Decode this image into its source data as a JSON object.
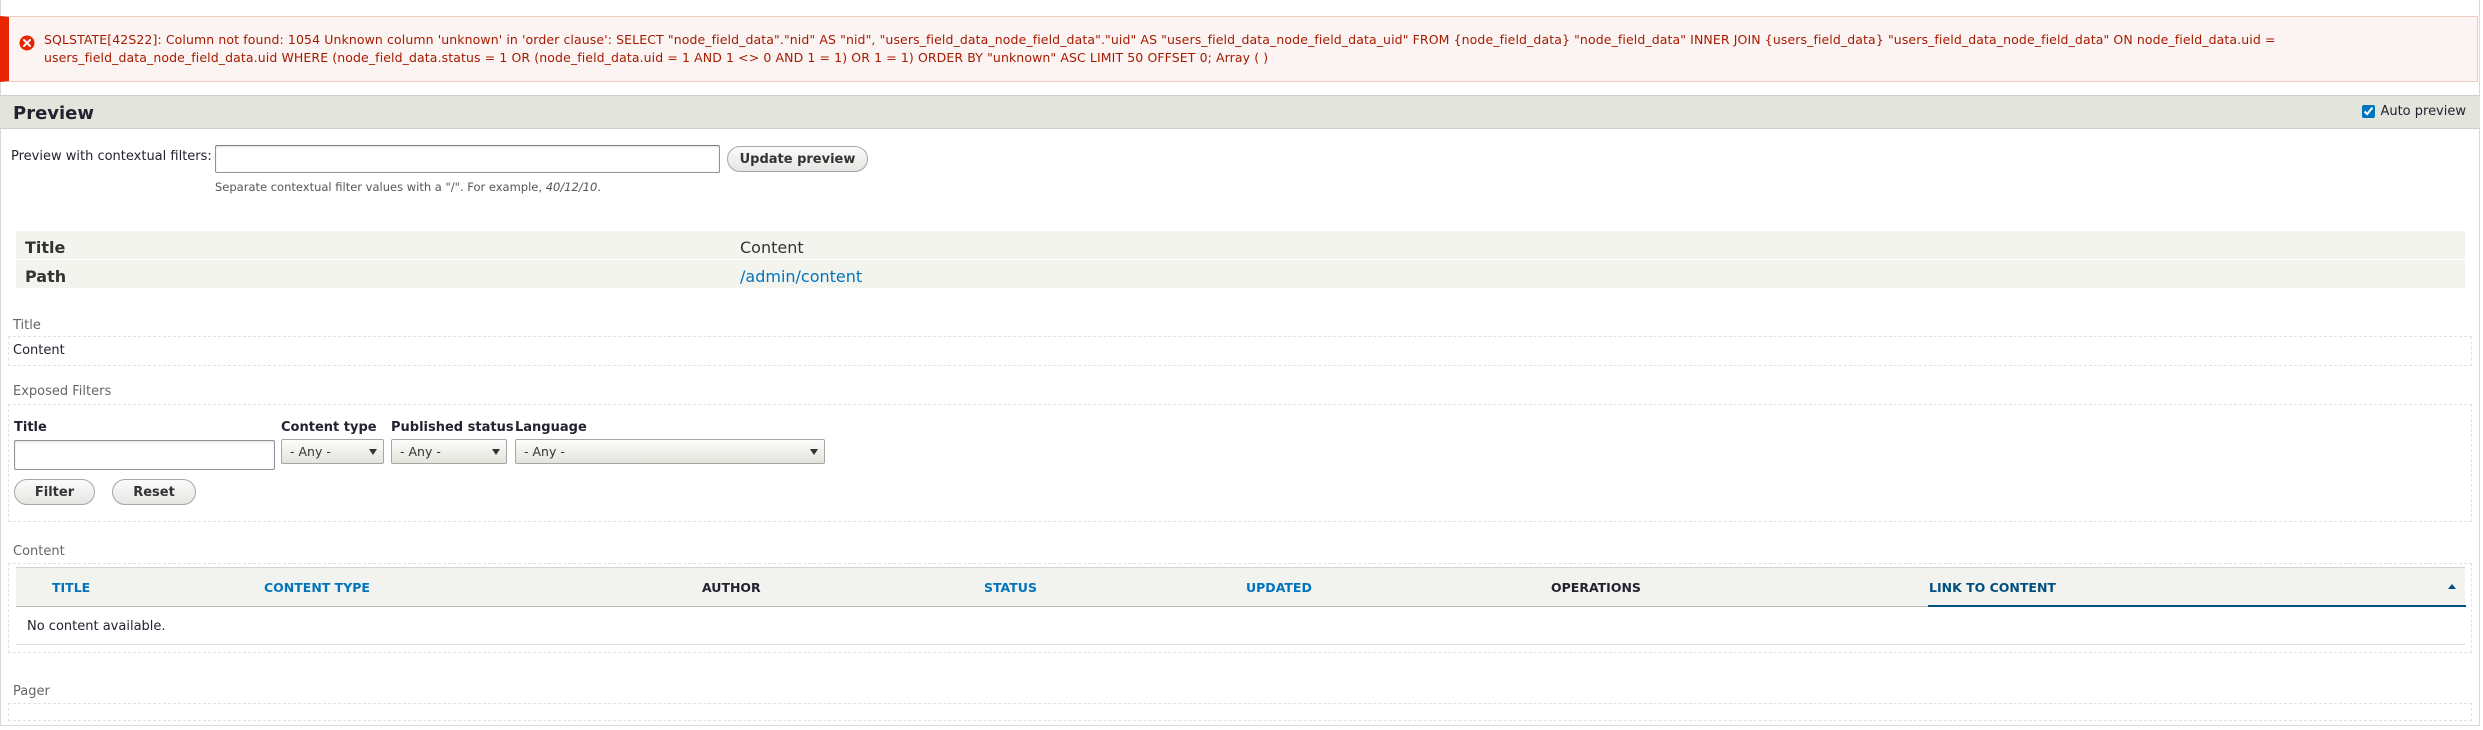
{
  "error": {
    "icon": "error-circle-icon",
    "message": "SQLSTATE[42S22]: Column not found: 1054 Unknown column 'unknown' in 'order clause': SELECT \"node_field_data\".\"nid\" AS \"nid\", \"users_field_data_node_field_data\".\"uid\" AS \"users_field_data_node_field_data_uid\" FROM {node_field_data} \"node_field_data\" INNER JOIN {users_field_data} \"users_field_data_node_field_data\" ON node_field_data.uid = users_field_data_node_field_data.uid WHERE (node_field_data.status = 1 OR (node_field_data.uid = 1 AND 1 <> 0 AND 1 = 1) OR 1 = 1) ORDER BY \"unknown\" ASC LIMIT 50 OFFSET 0; Array ( )",
    "color": "#a51b00"
  },
  "preview": {
    "title": "Preview",
    "auto_preview_label": "Auto preview",
    "auto_preview_checked": true,
    "contextual_label": "Preview with contextual filters:",
    "contextual_value": "",
    "update_button": "Update preview",
    "description_prefix": "Separate contextual filter values with a \"/\". For example, ",
    "description_example": "40/12/10",
    "description_suffix": "."
  },
  "info": {
    "rows": [
      {
        "key": "Title",
        "value": "Content"
      },
      {
        "key": "Path",
        "value": "/admin/content",
        "path_parts": [
          "/",
          "admin",
          "/",
          "content"
        ]
      }
    ]
  },
  "title_section": {
    "label": "Title",
    "value": "Content"
  },
  "exposed_filters": {
    "label": "Exposed Filters",
    "title_label": "Title",
    "title_value": "",
    "content_type_label": "Content type",
    "content_type_value": "- Any -",
    "published_label": "Published status",
    "published_value": "- Any -",
    "language_label": "Language",
    "language_value": "- Any -",
    "filter_button": "Filter",
    "reset_button": "Reset"
  },
  "content_section": {
    "label": "Content",
    "columns": [
      "Title",
      "Content type",
      "Author",
      "Status",
      "Updated",
      "Operations",
      "Link to content"
    ],
    "empty_text": "No content available."
  },
  "pager": {
    "label": "Pager"
  },
  "colors": {
    "link": "#0074bd",
    "active_sort": "#004f80",
    "error_border": "#e62600"
  }
}
